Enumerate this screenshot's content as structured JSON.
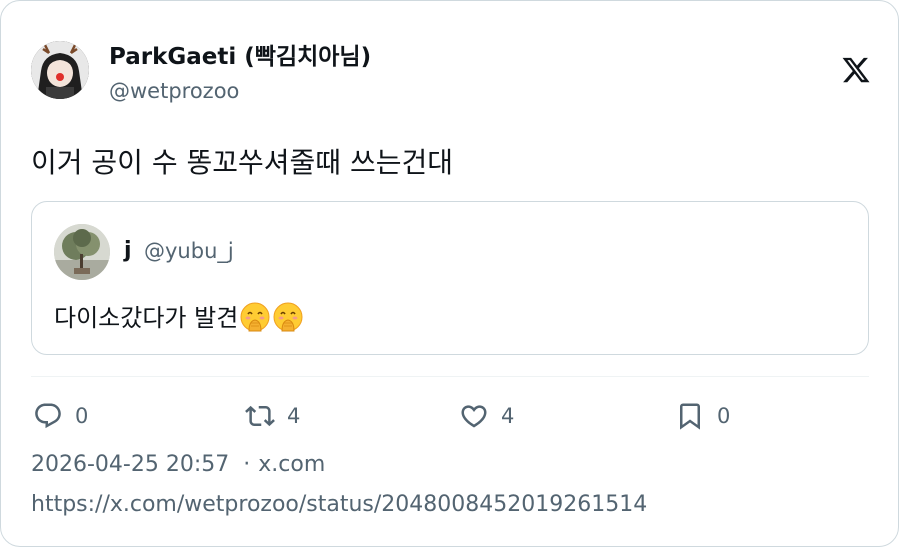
{
  "author": {
    "name": "ParkGaeti (빡김치아님)",
    "handle": "@wetprozoo"
  },
  "tweet": {
    "text": "이거 공이 수 똥꼬쑤셔줄때 쓰는건대"
  },
  "quote": {
    "name": "j",
    "handle": "@yubu_j",
    "text": "다이소갔다가 발견"
  },
  "actions": {
    "replies": "0",
    "retweets": "4",
    "likes": "4",
    "bookmarks": "0"
  },
  "meta": {
    "timestamp": "2026-04-25 20:57",
    "separator": "·",
    "source": "x.com",
    "url": "https://x.com/wetprozoo/status/2048008452019261514"
  },
  "icons": {
    "brand": "x-logo-icon",
    "reply": "reply-icon",
    "retweet": "retweet-icon",
    "like": "heart-icon",
    "bookmark": "bookmark-icon",
    "emoji": "face-with-hand-over-mouth-icon"
  },
  "colors": {
    "text": "#0f1419",
    "secondary": "#536471",
    "border": "#cfd9de"
  }
}
